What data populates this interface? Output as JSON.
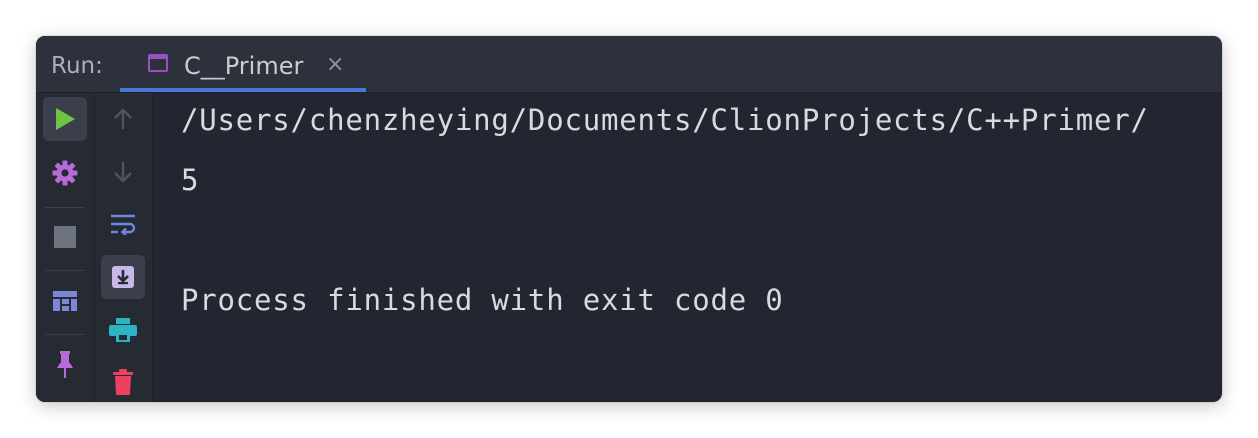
{
  "header": {
    "run_label": "Run:",
    "tab_title": "C__Primer",
    "tab_close": "×"
  },
  "left_toolbar": [
    {
      "name": "run-icon",
      "color": "#6cc644"
    },
    {
      "name": "gear-icon",
      "color": "#b76ad8"
    },
    {
      "name": "stop-icon",
      "color": "#6e7380"
    },
    {
      "name": "layout-icon",
      "color": "#7a86d8"
    },
    {
      "name": "pin-icon",
      "color": "#b76ad8"
    }
  ],
  "mid_toolbar": [
    {
      "name": "arrow-up-icon",
      "color": "#4d5360"
    },
    {
      "name": "arrow-down-icon",
      "color": "#4d5360"
    },
    {
      "name": "soft-wrap-icon",
      "color": "#6e86e0"
    },
    {
      "name": "scroll-to-end-icon",
      "color": "#c9b7e8"
    },
    {
      "name": "print-icon",
      "color": "#2bb5c4"
    },
    {
      "name": "trash-icon",
      "color": "#ef4062"
    }
  ],
  "console": {
    "path_line": "/Users/chenzheying/Documents/ClionProjects/C++Primer/",
    "output_line": "5",
    "exit_line": "Process finished with exit code 0"
  }
}
